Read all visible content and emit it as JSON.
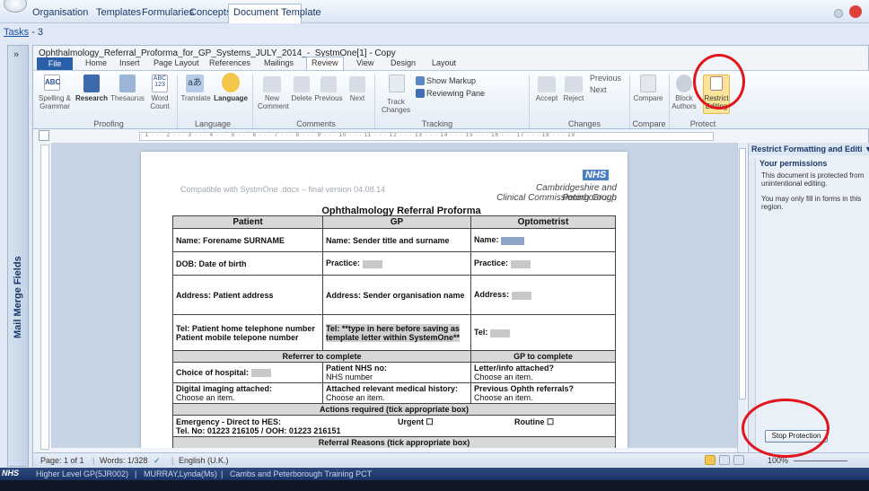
{
  "app_menu": {
    "items": [
      "Organisation",
      "Templates",
      "Formularies",
      "Concepts",
      "Document Template"
    ]
  },
  "tasks": {
    "link": "Tasks",
    "count": "- 3"
  },
  "left_panel": {
    "label": "Mail Merge Fields",
    "chevron": "»"
  },
  "word": {
    "doc_title": "Ophthalmology_Referral_Proforma_for_GP_Systems_JULY_2014_-_SystmOne[1] - Copy",
    "tabs": {
      "file": "File",
      "home": "Home",
      "insert": "Insert",
      "page_layout": "Page Layout",
      "references": "References",
      "mailings": "Mailings",
      "review": "Review",
      "view": "View",
      "design": "Design",
      "layout": "Layout"
    },
    "ribbon": {
      "proofing": "Proofing",
      "spelling": "Spelling & Grammar",
      "research": "Research",
      "thesaurus": "Thesaurus",
      "word_count": "Word Count",
      "language_group": "Language",
      "translate": "Translate",
      "language": "Language",
      "comments": "Comments",
      "new_comment": "New Comment",
      "delete": "Delete",
      "previous": "Previous",
      "next": "Next",
      "tracking": "Tracking",
      "track_changes": "Track Changes",
      "show_markup": "Show Markup",
      "reviewing_pane": "Reviewing Pane",
      "changes": "Changes",
      "accept": "Accept",
      "reject": "Reject",
      "previous2": "Previous",
      "next2": "Next",
      "compare_group": "Compare",
      "compare": "Compare",
      "protect": "Protect",
      "block_authors": "Block Authors",
      "restrict_editing": "Restrict Editing"
    }
  },
  "document": {
    "compat": "Compatible with SystmOne .docx – final version 04.08.14",
    "nhs": "NHS",
    "ccg_line1": "Cambridgeshire and Peterborough",
    "ccg_line2": "Clinical Commissioning Group",
    "title": "Ophthalmology Referral Proforma",
    "headers": [
      "Patient",
      "GP",
      "Optometrist"
    ],
    "rows": {
      "name_patient": "Name: Forename SURNAME",
      "name_gp": "Name: Sender title and surname",
      "name_opt": "Name:",
      "dob": "DOB: Date of birth",
      "practice_gp": "Practice:",
      "practice_opt": "Practice:",
      "address_patient": "Address: Patient address",
      "address_gp": "Address: Sender organisation name",
      "address_opt": "Address:",
      "tel_patient": "Tel: Patient home telephone number",
      "mobile_patient": "Patient mobile telepone number",
      "tel_gp": "Tel: **type in here before saving as template letter within SystemOne**",
      "tel_opt": "Tel:",
      "referrer_header": "Referrer to complete",
      "gp_header": "GP to complete",
      "choice_hospital": "Choice of hospital:",
      "patient_nhs": "Patient NHS no:",
      "nhs_number": "NHS number",
      "letter_attached": "Letter/info attached?",
      "choose1": "Choose an item.",
      "digital_imaging": "Digital imaging attached:",
      "choose2": "Choose an item.",
      "medical_history": "Attached relevant medical history:",
      "choose3": "Choose an item.",
      "prev_ophth": "Previous Ophth referrals?",
      "choose4": "Choose an item.",
      "actions_header": "Actions required (tick appropriate box)",
      "emergency": "Emergency - Direct to HES:",
      "tel_emergency": "Tel. No: 01223 216105 / OOH: 01223 216151",
      "urgent": "Urgent  ☐",
      "routine": "Routine  ☐",
      "reasons_header": "Referral Reasons (tick appropriate box)"
    }
  },
  "right_pane": {
    "title": "Restrict Formatting and Editi ▼ ×",
    "permissions": "Your permissions",
    "text1": "This document is protected from unintentional editing.",
    "text2": "You may only fill in forms in this region.",
    "stop_button": "Stop Protection"
  },
  "status": {
    "page": "Page: 1 of 1",
    "words": "Words: 1/328",
    "lang": "English (U.K.)",
    "zoom": "100%"
  },
  "bottom_bar": {
    "nhs": "NHS",
    "level": "Higher Level GP(5JR002)",
    "user": "MURRAY,Lynda(Ms)",
    "org": "Cambs and Peterborough Training PCT"
  }
}
